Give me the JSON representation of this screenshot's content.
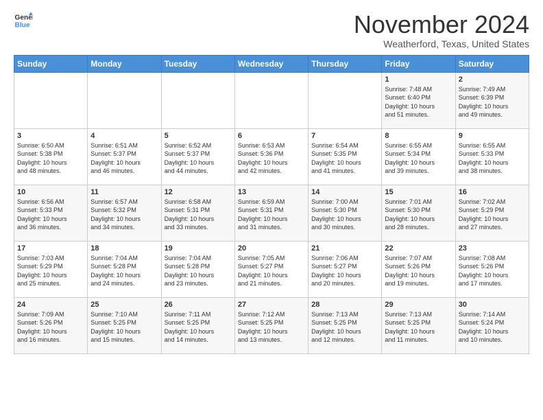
{
  "logo": {
    "line1": "General",
    "line2": "Blue"
  },
  "title": "November 2024",
  "location": "Weatherford, Texas, United States",
  "header": {
    "days": [
      "Sunday",
      "Monday",
      "Tuesday",
      "Wednesday",
      "Thursday",
      "Friday",
      "Saturday"
    ]
  },
  "weeks": [
    {
      "cells": [
        {
          "day": "",
          "info": ""
        },
        {
          "day": "",
          "info": ""
        },
        {
          "day": "",
          "info": ""
        },
        {
          "day": "",
          "info": ""
        },
        {
          "day": "",
          "info": ""
        },
        {
          "day": "1",
          "info": "Sunrise: 7:48 AM\nSunset: 6:40 PM\nDaylight: 10 hours\nand 51 minutes."
        },
        {
          "day": "2",
          "info": "Sunrise: 7:49 AM\nSunset: 6:39 PM\nDaylight: 10 hours\nand 49 minutes."
        }
      ]
    },
    {
      "cells": [
        {
          "day": "3",
          "info": "Sunrise: 6:50 AM\nSunset: 5:38 PM\nDaylight: 10 hours\nand 48 minutes."
        },
        {
          "day": "4",
          "info": "Sunrise: 6:51 AM\nSunset: 5:37 PM\nDaylight: 10 hours\nand 46 minutes."
        },
        {
          "day": "5",
          "info": "Sunrise: 6:52 AM\nSunset: 5:37 PM\nDaylight: 10 hours\nand 44 minutes."
        },
        {
          "day": "6",
          "info": "Sunrise: 6:53 AM\nSunset: 5:36 PM\nDaylight: 10 hours\nand 42 minutes."
        },
        {
          "day": "7",
          "info": "Sunrise: 6:54 AM\nSunset: 5:35 PM\nDaylight: 10 hours\nand 41 minutes."
        },
        {
          "day": "8",
          "info": "Sunrise: 6:55 AM\nSunset: 5:34 PM\nDaylight: 10 hours\nand 39 minutes."
        },
        {
          "day": "9",
          "info": "Sunrise: 6:55 AM\nSunset: 5:33 PM\nDaylight: 10 hours\nand 38 minutes."
        }
      ]
    },
    {
      "cells": [
        {
          "day": "10",
          "info": "Sunrise: 6:56 AM\nSunset: 5:33 PM\nDaylight: 10 hours\nand 36 minutes."
        },
        {
          "day": "11",
          "info": "Sunrise: 6:57 AM\nSunset: 5:32 PM\nDaylight: 10 hours\nand 34 minutes."
        },
        {
          "day": "12",
          "info": "Sunrise: 6:58 AM\nSunset: 5:31 PM\nDaylight: 10 hours\nand 33 minutes."
        },
        {
          "day": "13",
          "info": "Sunrise: 6:59 AM\nSunset: 5:31 PM\nDaylight: 10 hours\nand 31 minutes."
        },
        {
          "day": "14",
          "info": "Sunrise: 7:00 AM\nSunset: 5:30 PM\nDaylight: 10 hours\nand 30 minutes."
        },
        {
          "day": "15",
          "info": "Sunrise: 7:01 AM\nSunset: 5:30 PM\nDaylight: 10 hours\nand 28 minutes."
        },
        {
          "day": "16",
          "info": "Sunrise: 7:02 AM\nSunset: 5:29 PM\nDaylight: 10 hours\nand 27 minutes."
        }
      ]
    },
    {
      "cells": [
        {
          "day": "17",
          "info": "Sunrise: 7:03 AM\nSunset: 5:29 PM\nDaylight: 10 hours\nand 25 minutes."
        },
        {
          "day": "18",
          "info": "Sunrise: 7:04 AM\nSunset: 5:28 PM\nDaylight: 10 hours\nand 24 minutes."
        },
        {
          "day": "19",
          "info": "Sunrise: 7:04 AM\nSunset: 5:28 PM\nDaylight: 10 hours\nand 23 minutes."
        },
        {
          "day": "20",
          "info": "Sunrise: 7:05 AM\nSunset: 5:27 PM\nDaylight: 10 hours\nand 21 minutes."
        },
        {
          "day": "21",
          "info": "Sunrise: 7:06 AM\nSunset: 5:27 PM\nDaylight: 10 hours\nand 20 minutes."
        },
        {
          "day": "22",
          "info": "Sunrise: 7:07 AM\nSunset: 5:26 PM\nDaylight: 10 hours\nand 19 minutes."
        },
        {
          "day": "23",
          "info": "Sunrise: 7:08 AM\nSunset: 5:26 PM\nDaylight: 10 hours\nand 17 minutes."
        }
      ]
    },
    {
      "cells": [
        {
          "day": "24",
          "info": "Sunrise: 7:09 AM\nSunset: 5:26 PM\nDaylight: 10 hours\nand 16 minutes."
        },
        {
          "day": "25",
          "info": "Sunrise: 7:10 AM\nSunset: 5:25 PM\nDaylight: 10 hours\nand 15 minutes."
        },
        {
          "day": "26",
          "info": "Sunrise: 7:11 AM\nSunset: 5:25 PM\nDaylight: 10 hours\nand 14 minutes."
        },
        {
          "day": "27",
          "info": "Sunrise: 7:12 AM\nSunset: 5:25 PM\nDaylight: 10 hours\nand 13 minutes."
        },
        {
          "day": "28",
          "info": "Sunrise: 7:13 AM\nSunset: 5:25 PM\nDaylight: 10 hours\nand 12 minutes."
        },
        {
          "day": "29",
          "info": "Sunrise: 7:13 AM\nSunset: 5:25 PM\nDaylight: 10 hours\nand 11 minutes."
        },
        {
          "day": "30",
          "info": "Sunrise: 7:14 AM\nSunset: 5:24 PM\nDaylight: 10 hours\nand 10 minutes."
        }
      ]
    }
  ]
}
